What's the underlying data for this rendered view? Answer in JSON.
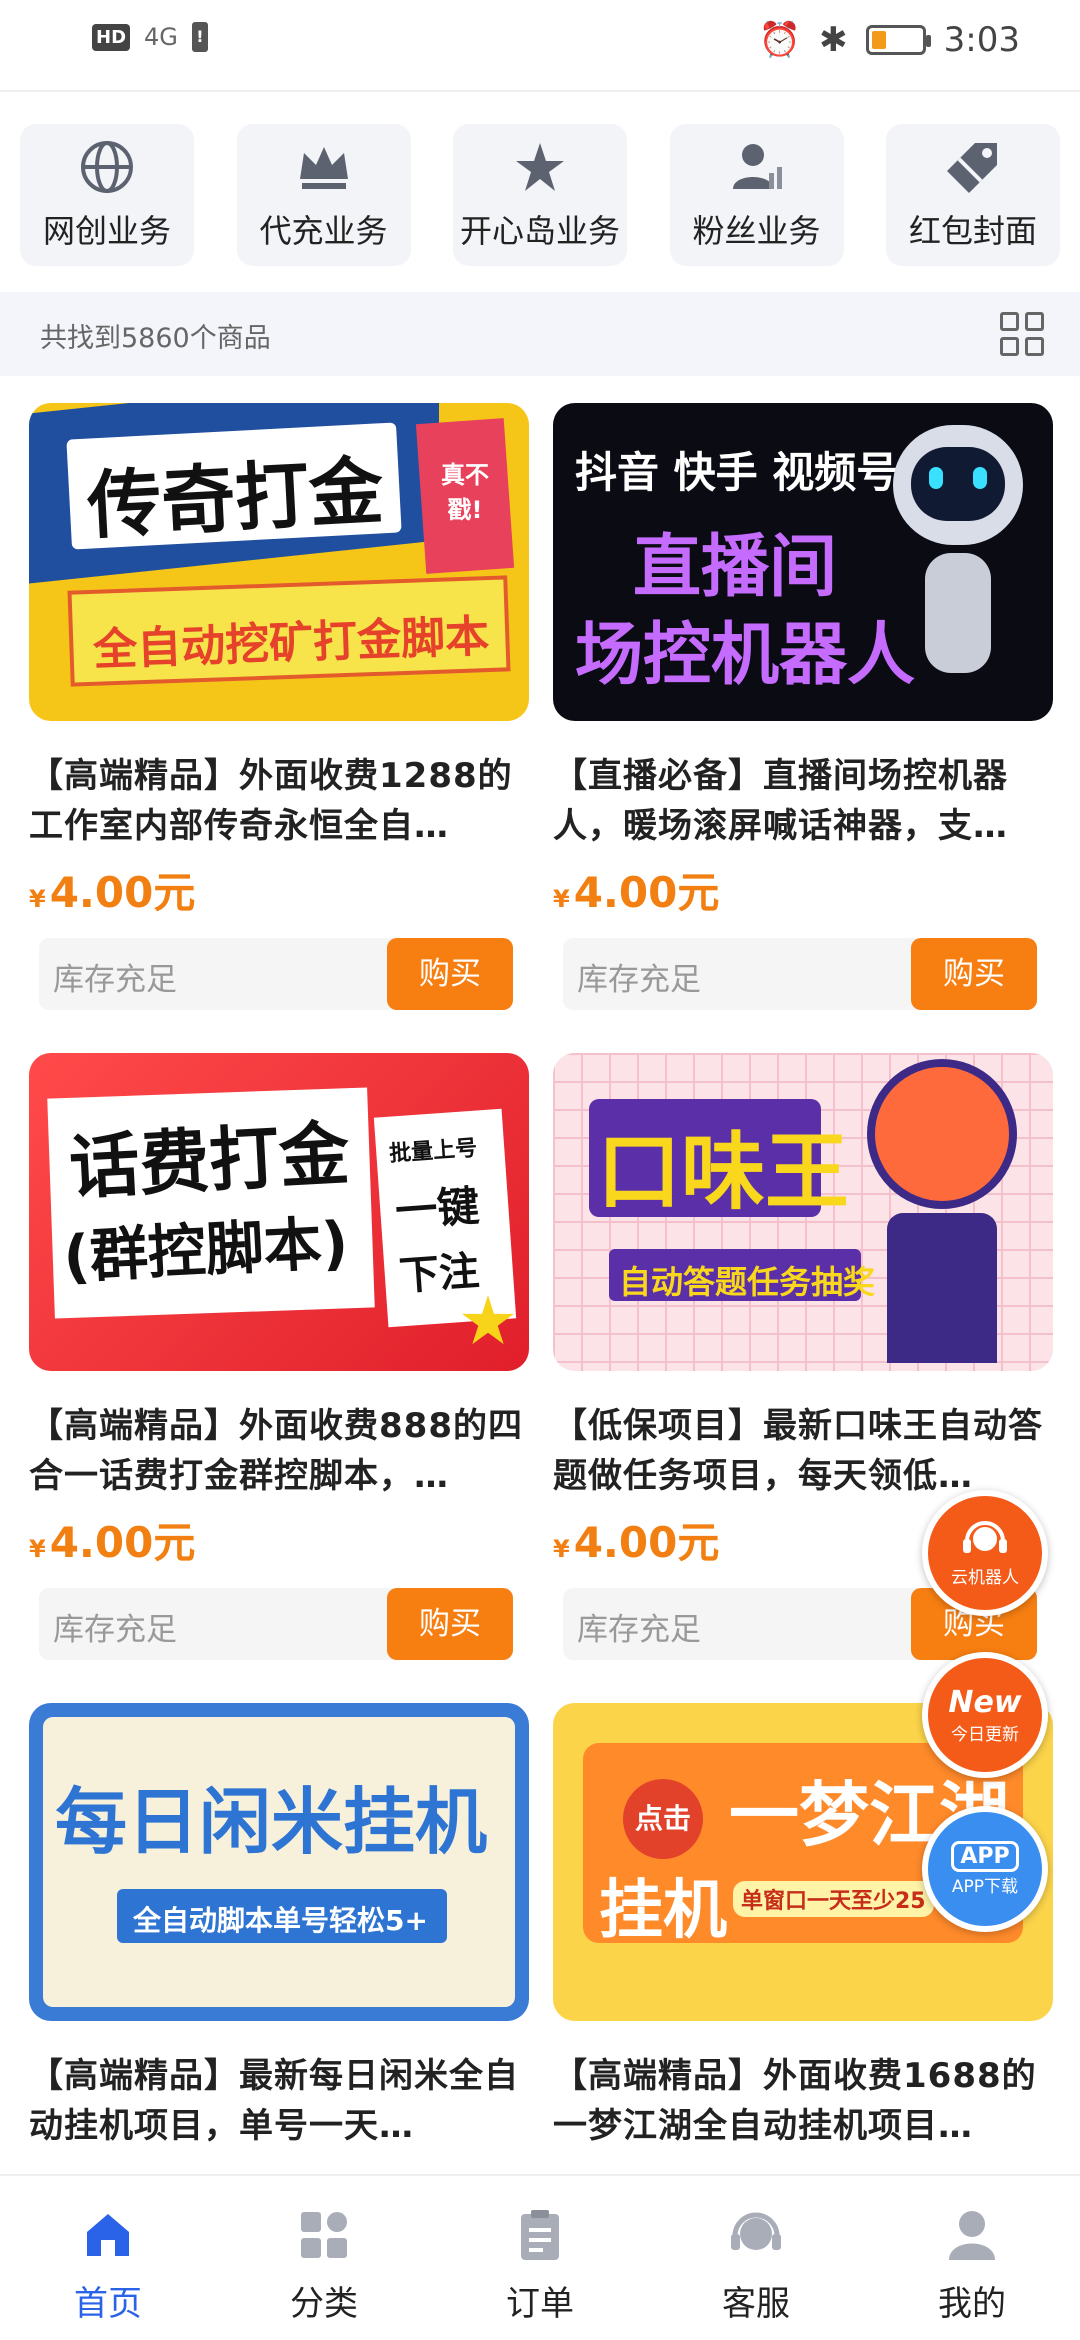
{
  "status_bar": {
    "network": "HD",
    "signal": "4G",
    "time": "3:03"
  },
  "categories": [
    {
      "label": "网创业务",
      "icon": "globe-icon"
    },
    {
      "label": "代充业务",
      "icon": "crown-icon"
    },
    {
      "label": "开心岛业务",
      "icon": "star-icon"
    },
    {
      "label": "粉丝业务",
      "icon": "user-chart-icon"
    },
    {
      "label": "红包封面",
      "icon": "tag-icon"
    }
  ],
  "result_count": "共找到5860个商品",
  "products": [
    {
      "title": "【高端精品】外面收费1288的工作室内部传奇永恒全自…",
      "price": "4.00元",
      "currency": "¥",
      "stock": "库存充足",
      "buy": "购买",
      "thumb": {
        "line1": "传奇打金",
        "line2": "全自动挖矿打金脚本",
        "badge": "真不戳!"
      }
    },
    {
      "title": "【直播必备】直播间场控机器人，暖场滚屏喊话神器，支…",
      "price": "4.00元",
      "currency": "¥",
      "stock": "库存充足",
      "buy": "购买",
      "thumb": {
        "line1": "抖音 快手 视频号",
        "line2": "直播间",
        "line3": "场控机器人"
      }
    },
    {
      "title": "【高端精品】外面收费888的四合一话费打金群控脚本，…",
      "price": "4.00元",
      "currency": "¥",
      "stock": "库存充足",
      "buy": "购买",
      "thumb": {
        "line1": "话费打金",
        "line2": "(群控脚本)",
        "side1": "批量上号",
        "side2": "一键",
        "side3": "下注"
      }
    },
    {
      "title": "【低保项目】最新口味王自动答题做任务项目，每天领低…",
      "price": "4.00元",
      "currency": "¥",
      "stock": "库存充足",
      "buy": "购买",
      "thumb": {
        "line1": "口味王",
        "line2": "自动答题任务抽奖"
      }
    },
    {
      "title": "【高端精品】最新每日闲米全自动挂机项目，单号一天…",
      "thumb": {
        "line1": "每日闲米挂机",
        "line2": "全自动脚本单号轻松5+"
      }
    },
    {
      "title": "【高端精品】外面收费1688的一梦江湖全自动挂机项目…",
      "thumb": {
        "line1": "一梦江湖",
        "line2": "挂机",
        "badge": "点击",
        "line3": "单窗口一天至少25"
      }
    }
  ],
  "floating": [
    {
      "label": "云机器人",
      "icon": "headset-icon"
    },
    {
      "label": "今日更新",
      "big": "New"
    },
    {
      "label": "APP下载",
      "big": "APP"
    }
  ],
  "tabs": [
    {
      "label": "首页",
      "icon": "home-icon",
      "active": true
    },
    {
      "label": "分类",
      "icon": "grid-icon"
    },
    {
      "label": "订单",
      "icon": "clipboard-icon"
    },
    {
      "label": "客服",
      "icon": "support-icon"
    },
    {
      "label": "我的",
      "icon": "profile-icon"
    }
  ],
  "colors": {
    "accent": "#f77f12",
    "active_tab": "#2b63e8",
    "fab": "#f45b18",
    "fab_blue": "#3a8ef0"
  }
}
